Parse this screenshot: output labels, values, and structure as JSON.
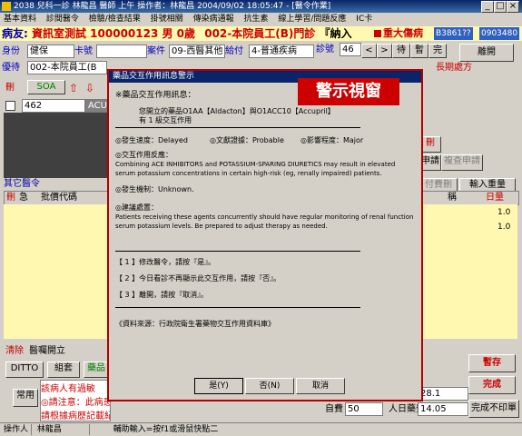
{
  "window": {
    "title": "2038 兒科一診 林龍昌 醫師 上午 操作者：林龍昌  2004/09/02 18:05:47 - [醫令作業]"
  },
  "menu": {
    "items": [
      "基本資料",
      "診間醫令",
      "檢驗/檢查結果",
      "掛號相關",
      "傳染病通報",
      "抗生素",
      "線上學習/問題反應",
      "IC卡"
    ]
  },
  "patient": {
    "label": "病友:",
    "name_line": "資訊室測試  100000123 男 0歲",
    "dept": "002-本院員工(B)門診",
    "nahru": "『納入",
    "alert": "重大傷病",
    "id_code": "B3861??",
    "card_code": "0903480"
  },
  "form": {
    "identity_label": "身份",
    "identity_value": "健保",
    "card_label": "卡號",
    "card_value": "",
    "case_label": "案件",
    "case_value": "09-西醫其他",
    "payment_label": "給付",
    "payment_value": "4-普通疾病",
    "visit_no_label": "診號",
    "visit_no_value": "46",
    "preferential_label": "優待",
    "preferential_value": "002-本院員工(B",
    "hospital_label": "病",
    "chronic_label": "長期處方",
    "nav_buttons": [
      "<",
      ">",
      "待",
      "暫",
      "完"
    ],
    "leave_button": "離開"
  },
  "diagnosis": {
    "delete_label": "刪",
    "soa_label": "SOA",
    "row_code": "462",
    "row_extra": "ACU"
  },
  "right_side": {
    "btn1": "刪",
    "btn2": "申請",
    "btn3": "複查申請",
    "btn4": "付費刪",
    "btn5": "輸入重量",
    "col_name": "稱",
    "col_dose": "日量",
    "row1": "1.0",
    "row2": "1.0"
  },
  "orders": {
    "section_title": "其它醫令",
    "col_delete": "刪",
    "col_urgent": "急",
    "col_code": "批價代碼"
  },
  "bottom": {
    "delete_label": "淸除",
    "open_label": "醫囑開立",
    "ditto": "DITTO",
    "group": "組套",
    "drug": "藥品",
    "common": "常用",
    "note1": "該病人有過敏",
    "note2": "◎請注意：此病患最近沒有做過手術病歷",
    "note3": "請根據病歷記載紀錄,或再確認開立醫囑",
    "save_button": "暫存",
    "done_button": "完成",
    "no_print_button": "完成不印單",
    "days_label": "自費",
    "days_value": "50",
    "cost_label": "人日藥費",
    "cost_value": "14.05",
    "amount_value": "28.1"
  },
  "status": {
    "operator_label": "操作人",
    "operator_name": "林龍昌",
    "hint": "輔助輸入=按f1或滑鼠快點二"
  },
  "dialog": {
    "title": "藥品交互作用訊息警示",
    "badge": "警示視窗",
    "header": "※藥品交互作用訊息：",
    "pair": "您開立的藥品O1AA【Aldacton】與O1ACC10【Accupril】",
    "count": "有 1 級交互作用",
    "onset": "◎發生速度：Delayed",
    "doc": "◎文獻證據：Probable",
    "severity": "◎影響程度：Major",
    "effect_title": "◎交互作用反應：",
    "effect1": "Combining ACE INHIBITORS and POTASSIUM-SPARING DIURETICS may result in elevated",
    "effect2": "serum potassium concentrations in certain high-risk (eg, renally impaired) patients.",
    "mechanism": "◎發生機制：Unknown.",
    "advice_title": "◎建議處置：",
    "advice1": "Patients receiving these agents concurrently should have regular monitoring of renal function and",
    "advice2": "serum potassium levels. Be prepared to adjust therapy as needed.",
    "option1": "【 1 】修改醫令，請按『是』。",
    "option2": "【 2 】今日看診不再顯示此交互作用，請按『否』。",
    "option3": "【 3 】離開，請按『取消』。",
    "source": "《資料來源：行政院衛生署藥物交互作用資料庫》",
    "yes": "是(Y)",
    "no": "否(N)",
    "cancel": "取消"
  }
}
